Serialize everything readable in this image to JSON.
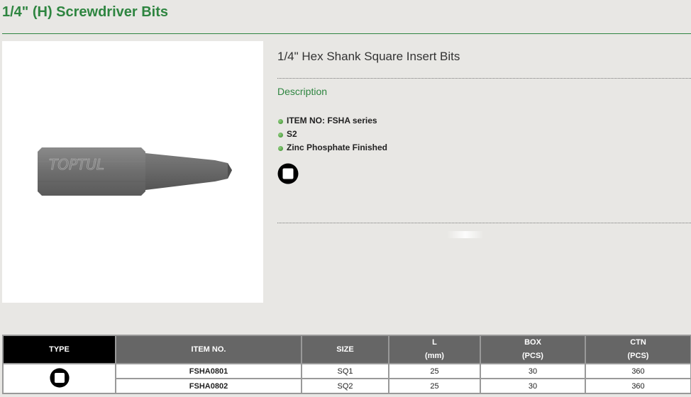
{
  "page_title": "1/4\" (H) Screwdriver Bits",
  "product": {
    "name": "1/4\" Hex Shank Square Insert Bits",
    "image_brand_text": "TOPTUL",
    "description_heading": "Description",
    "features": [
      "ITEM NO: FSHA series",
      "S2",
      "Zinc Phosphate Finished"
    ],
    "type_icon": "square-drive-icon"
  },
  "table": {
    "headers": {
      "type": "TYPE",
      "item_no": "ITEM NO.",
      "size": "SIZE",
      "l_line1": "L",
      "l_line2": "(mm)",
      "box_line1": "BOX",
      "box_line2": "(PCS)",
      "ctn_line1": "CTN",
      "ctn_line2": "(PCS)"
    },
    "rows": [
      {
        "item_no": "FSHA0801",
        "size": "SQ1",
        "l": "25",
        "box": "30",
        "ctn": "360"
      },
      {
        "item_no": "FSHA0802",
        "size": "SQ2",
        "l": "25",
        "box": "30",
        "ctn": "360"
      }
    ]
  },
  "colors": {
    "accent_green": "#2e8540",
    "header_gray": "#666666",
    "type_header_black": "#000000"
  }
}
